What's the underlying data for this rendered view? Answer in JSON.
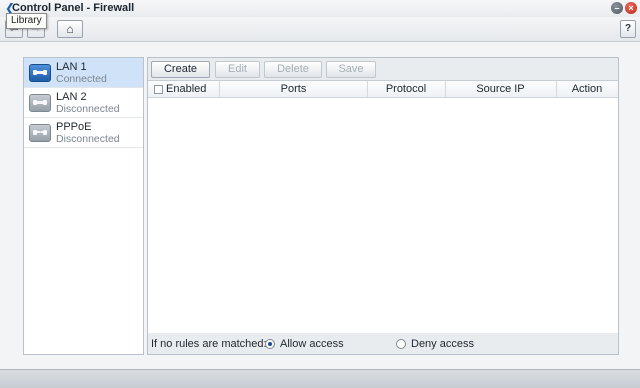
{
  "window": {
    "title": "Control Panel - Firewall"
  },
  "toolbar": {
    "back_glyph": "⇦",
    "forward_glyph": "⇨",
    "home_glyph": "⌂",
    "help_label": "?",
    "tooltip": "Library"
  },
  "networks": [
    {
      "name": "LAN 1",
      "status": "Connected",
      "icon": "lan-icon",
      "selected": true
    },
    {
      "name": "LAN 2",
      "status": "Disconnected",
      "icon": "lan-icon",
      "selected": false
    },
    {
      "name": "PPPoE",
      "status": "Disconnected",
      "icon": "pppoe-icon",
      "selected": false
    }
  ],
  "actions": {
    "create": "Create",
    "edit": "Edit",
    "delete": "Delete",
    "save": "Save"
  },
  "table": {
    "columns": [
      "Enabled",
      "Ports",
      "Protocol",
      "Source IP",
      "Action"
    ],
    "rows": []
  },
  "default_policy": {
    "label": "If no rules are matched:",
    "allow": "Allow access",
    "deny": "Deny access",
    "selected": "allow"
  },
  "colors": {
    "accent": "#1f5ca8",
    "selection": "#cfe2f8",
    "close": "#d2382a"
  }
}
